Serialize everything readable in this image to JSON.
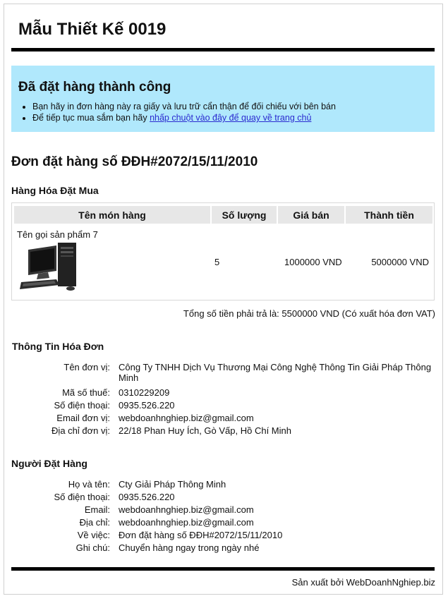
{
  "header": {
    "title": "Mẫu Thiết Kế 0019"
  },
  "success": {
    "heading": "Đã đặt hàng thành công",
    "line1": "Bạn hãy in đơn hàng này ra giấy và lưu trữ cẩn thận để đối chiếu với bên bán",
    "line2_text": "Để tiếp tục mua sắm bạn hãy ",
    "line2_link": "nhấp chuột vào đây để quay về trang chủ"
  },
  "order": {
    "title": "Đơn đặt hàng số ĐĐH#2072/15/11/2010"
  },
  "goods": {
    "section_title": "Hàng Hóa Đặt Mua",
    "columns": [
      "Tên món hàng",
      "Số lượng",
      "Giá bán",
      "Thành tiền"
    ],
    "rows": [
      {
        "name": "Tên gọi sản phẩm 7",
        "quantity": "5",
        "price": "1000000 VND",
        "subtotal": "5000000 VND",
        "icon": "desktop-computer-icon"
      }
    ],
    "total": "Tổng số tiền phải trả là: 5500000 VND (Có xuất hóa đơn VAT)"
  },
  "invoice": {
    "section_title": "Thông Tin Hóa Đơn",
    "fields": [
      {
        "label": "Tên đơn vị:",
        "value": "Công Ty TNHH Dịch Vụ Thương Mại Công Nghệ Thông Tin Giải Pháp Thông Minh"
      },
      {
        "label": "Mã số thuế:",
        "value": "0310229209"
      },
      {
        "label": "Số điện thoại:",
        "value": "0935.526.220"
      },
      {
        "label": "Email đơn vị:",
        "value": "webdoanhnghiep.biz@gmail.com"
      },
      {
        "label": "Địa chỉ đơn vị:",
        "value": "22/18 Phan Huy Ích, Gò Vấp, Hồ Chí Minh"
      }
    ]
  },
  "buyer": {
    "section_title": "Người Đặt Hàng",
    "fields": [
      {
        "label": "Họ và tên:",
        "value": "Cty Giải Pháp Thông Minh"
      },
      {
        "label": "Số điện thoại:",
        "value": "0935.526.220"
      },
      {
        "label": "Email:",
        "value": "webdoanhnghiep.biz@gmail.com"
      },
      {
        "label": "Địa chỉ:",
        "value": "webdoanhnghiep.biz@gmail.com"
      },
      {
        "label": "Về việc:",
        "value": "Đơn đặt hàng số ĐĐH#2072/15/11/2010"
      },
      {
        "label": "Ghi chú:",
        "value": "Chuyển hàng ngay trong ngày nhé"
      }
    ]
  },
  "footer": {
    "text": "Sản xuất bởi WebDoanhNghiep.biz"
  }
}
